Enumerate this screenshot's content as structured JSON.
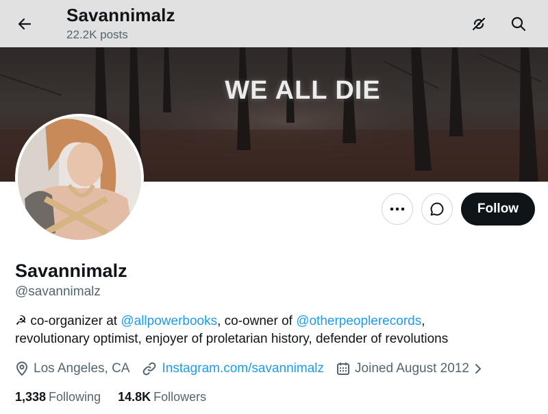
{
  "header": {
    "title": "Savannimalz",
    "posts_count": "22.2K posts",
    "back_icon": "arrow-left-icon",
    "icons": [
      "satellite-off-icon",
      "search-icon"
    ]
  },
  "banner": {
    "text": "WE ALL DIE"
  },
  "profile": {
    "display_name": "Savannimalz",
    "handle": "@savannimalz",
    "bio": {
      "emoji": "☭",
      "part1": " co-organizer at ",
      "mention1": "@allpowerbooks",
      "part2": ", co-owner of ",
      "mention2": "@otherpeoplerecords",
      "part3": ",",
      "line2": "revolutionary optimist, enjoyer of proletarian history, defender of revolutions"
    },
    "location": "Los Angeles, CA",
    "website": "Instagram.com/savannimalz",
    "joined": "Joined August 2012"
  },
  "actions": {
    "more_icon": "more-icon",
    "message_icon": "message-icon",
    "follow_label": "Follow"
  },
  "stats": {
    "following_count": "1,338",
    "following_label": "Following",
    "followers_count": "14.8K",
    "followers_label": "Followers"
  },
  "colors": {
    "accent": "#1d9bf0",
    "text": "#0f1419",
    "secondary": "#536471",
    "header_bg": "#e1e1e1",
    "follow_bg": "#0f1419"
  }
}
